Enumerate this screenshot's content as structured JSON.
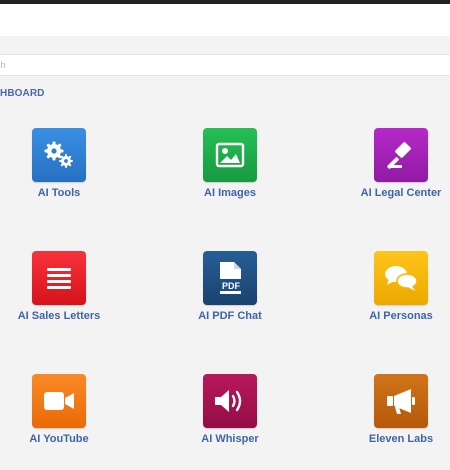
{
  "search": {
    "placeholder": "ch"
  },
  "section": {
    "title": "HBOARD"
  },
  "tiles": [
    {
      "label": "AI Tools",
      "icon": "gears-icon",
      "color": "#2d7fd3"
    },
    {
      "label": "AI Images",
      "icon": "image-icon",
      "color": "#1fae4a"
    },
    {
      "label": "AI Legal Center",
      "icon": "gavel-icon",
      "color": "#a51fb8"
    },
    {
      "label": "AI Sales Letters",
      "icon": "list-icon",
      "color": "#ee1c24"
    },
    {
      "label": "AI PDF Chat",
      "icon": "pdf-file-icon",
      "color": "#1f4f82"
    },
    {
      "label": "AI Personas",
      "icon": "chat-bubbles-icon",
      "color": "#f4b800"
    },
    {
      "label": "AI YouTube",
      "icon": "video-camera-icon",
      "color": "#f47a12"
    },
    {
      "label": "AI Whisper",
      "icon": "speaker-icon",
      "color": "#a8114f"
    },
    {
      "label": "Eleven Labs",
      "icon": "megaphone-icon",
      "color": "#c4650f"
    }
  ]
}
